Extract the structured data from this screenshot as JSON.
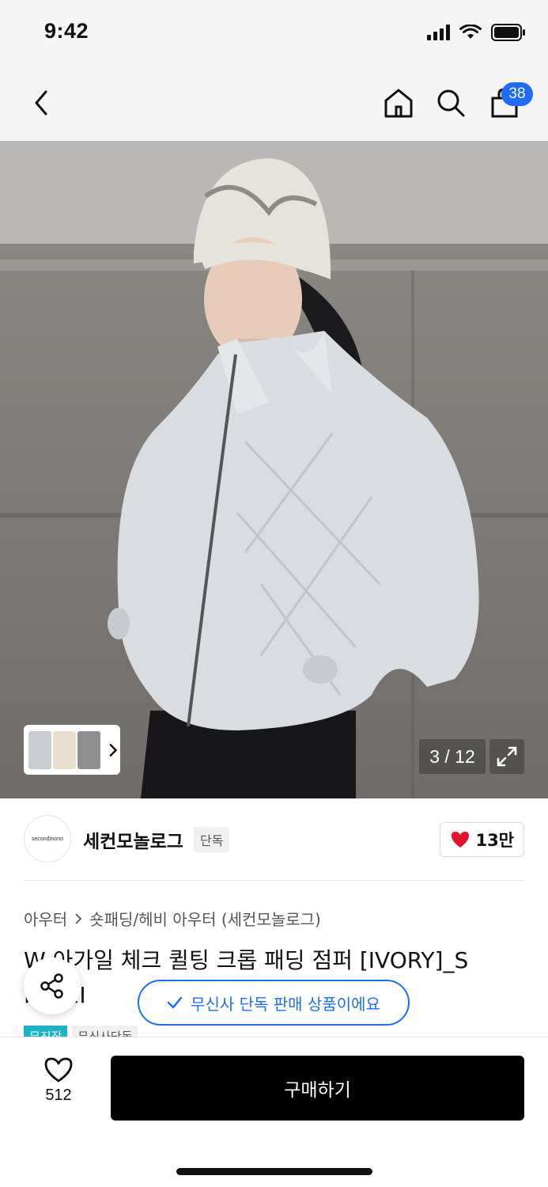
{
  "status_bar": {
    "time": "9:42"
  },
  "nav": {
    "cart_count": "38"
  },
  "gallery": {
    "counter": "3 / 12"
  },
  "brand": {
    "logo_text": "secondmono",
    "name": "세컨모놀로그",
    "tag": "단독",
    "likes": "13만"
  },
  "breadcrumb": {
    "level1": "아우터",
    "level2": "숏패딩/헤비 아우터 (세컨모놀로그)"
  },
  "product": {
    "title": "W 아가일 체크 퀼팅 크롭 패딩 점퍼 [IVORY]_S P001I",
    "tags": [
      "무진장",
      "무신사단독"
    ]
  },
  "exclusive_notice": "무신사 단독 판매 상품이에요",
  "bottom": {
    "wish_count": "512",
    "buy_label": "구매하기"
  },
  "colors": {
    "accent": "#1f6bff",
    "heart": "#e8112d",
    "tag_teal": "#1ab4c8",
    "buy_button": "#000000"
  }
}
